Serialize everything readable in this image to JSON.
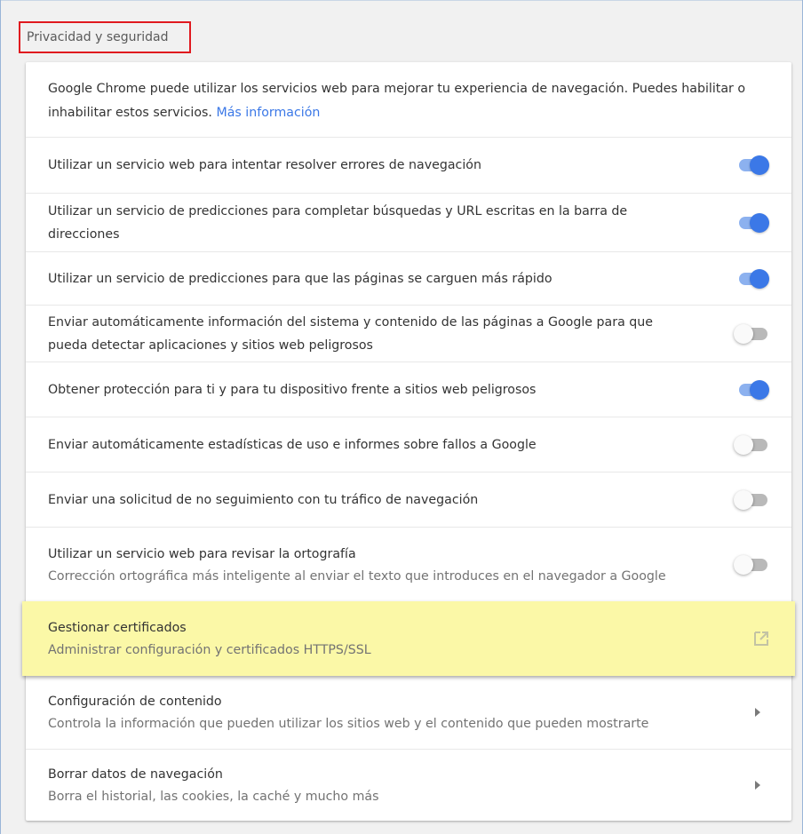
{
  "section": {
    "title": "Privacidad y seguridad"
  },
  "intro": {
    "text": "Google Chrome puede utilizar los servicios web para mejorar tu experiencia de navegación. Puedes habilitar o inhabilitar estos servicios.",
    "link": "Más información"
  },
  "toggles": [
    {
      "label": "Utilizar un servicio web para intentar resolver errores de navegación",
      "on": true
    },
    {
      "label": "Utilizar un servicio de predicciones para completar búsquedas y URL escritas en la barra de direcciones",
      "on": true
    },
    {
      "label": "Utilizar un servicio de predicciones para que las páginas se carguen más rápido",
      "on": true
    },
    {
      "label": "Enviar automáticamente información del sistema y contenido de las páginas a Google para que pueda detectar aplicaciones y sitios web peligrosos",
      "on": false
    },
    {
      "label": "Obtener protección para ti y para tu dispositivo frente a sitios web peligrosos",
      "on": true
    },
    {
      "label": "Enviar automáticamente estadísticas de uso e informes sobre fallos a Google",
      "on": false
    },
    {
      "label": "Enviar una solicitud de no seguimiento con tu tráfico de navegación",
      "on": false
    },
    {
      "label": "Utilizar un servicio web para revisar la ortografía",
      "sublabel": "Corrección ortográfica más inteligente al enviar el texto que introduces en el navegador a Google",
      "on": false
    }
  ],
  "certificates": {
    "title": "Gestionar certificados",
    "subtitle": "Administrar configuración y certificados HTTPS/SSL",
    "icon": "open-in-new-icon"
  },
  "links": [
    {
      "title": "Configuración de contenido",
      "subtitle": "Controla la información que pueden utilizar los sitios web y el contenido que pueden mostrarte",
      "icon": "chevron-right-icon"
    },
    {
      "title": "Borrar datos de navegación",
      "subtitle": "Borra el historial, las cookies, la caché y mucho más",
      "icon": "chevron-right-icon"
    }
  ],
  "colors": {
    "accent": "#3b78e7",
    "highlight": "#fbf8a7",
    "title_outline": "#e0191f"
  }
}
